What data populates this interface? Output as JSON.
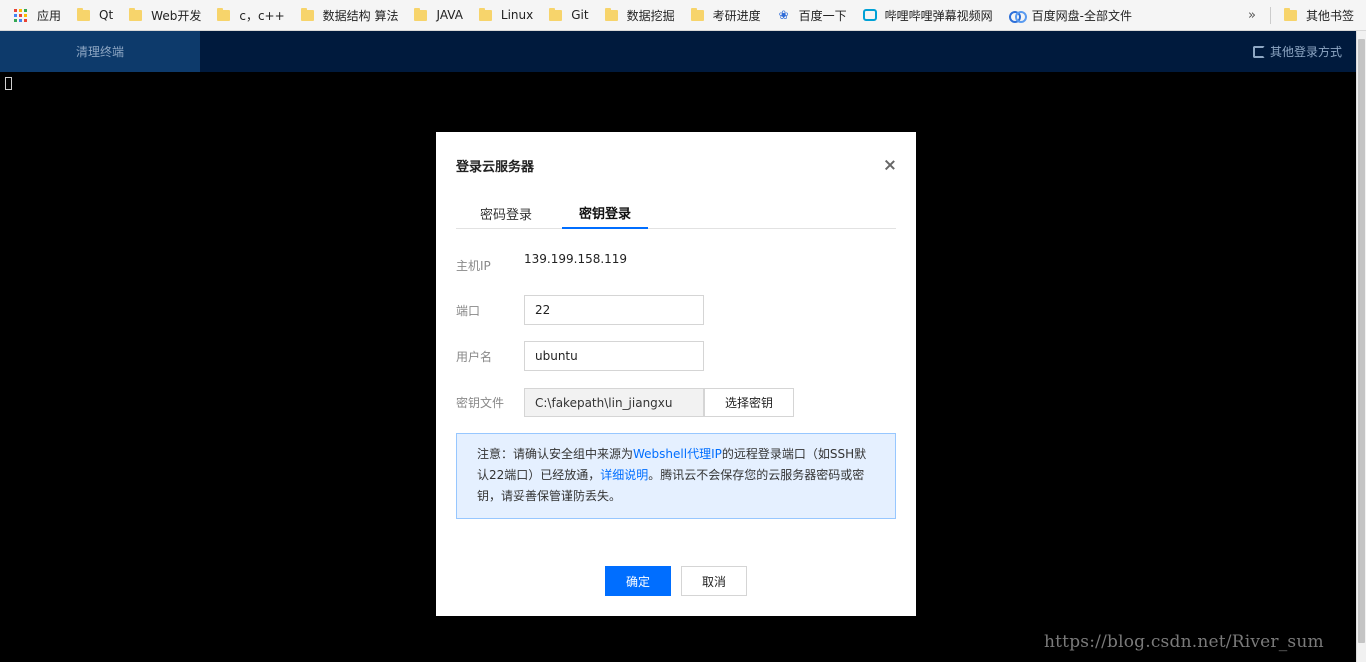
{
  "bookmarks": {
    "apps_label": "应用",
    "items": [
      "Qt",
      "Web开发",
      "c，c++",
      "数据结构 算法",
      "JAVA",
      "Linux",
      "Git",
      "数据挖掘",
      "考研进度"
    ],
    "baidu": "百度一下",
    "bilibili": "哔哩哔哩弹幕视频网",
    "baidupan": "百度网盘-全部文件",
    "more": "»",
    "other": "其他书签"
  },
  "header": {
    "active_tab": "清理终端",
    "other_login": "其他登录方式"
  },
  "modal": {
    "title": "登录云服务器",
    "tabs": [
      "密码登录",
      "密钥登录"
    ],
    "active_tab_index": 1,
    "host_label": "主机IP",
    "host_value": "139.199.158.119",
    "port_label": "端口",
    "port_value": "22",
    "user_label": "用户名",
    "user_value": "ubuntu",
    "key_label": "密钥文件",
    "key_path": "C:\\fakepath\\lin_jiangxu",
    "key_button": "选择密钥",
    "notice": {
      "p1": "注意：请确认安全组中来源为",
      "link1": "Webshell代理IP",
      "p2": "的远程登录端口（如SSH默认22端口）已经放通，",
      "link2": "详细说明",
      "p3": "。腾讯云不会保存您的云服务器密码或密钥，请妥善保管谨防丢失。"
    },
    "ok": "确定",
    "cancel": "取消"
  },
  "watermark": "https://blog.csdn.net/River_sum",
  "colors": {
    "primary": "#006eff",
    "header_bg": "#001a3d",
    "active_tab_bg": "#0d3a6b",
    "notice_bg": "#e5f0ff"
  }
}
